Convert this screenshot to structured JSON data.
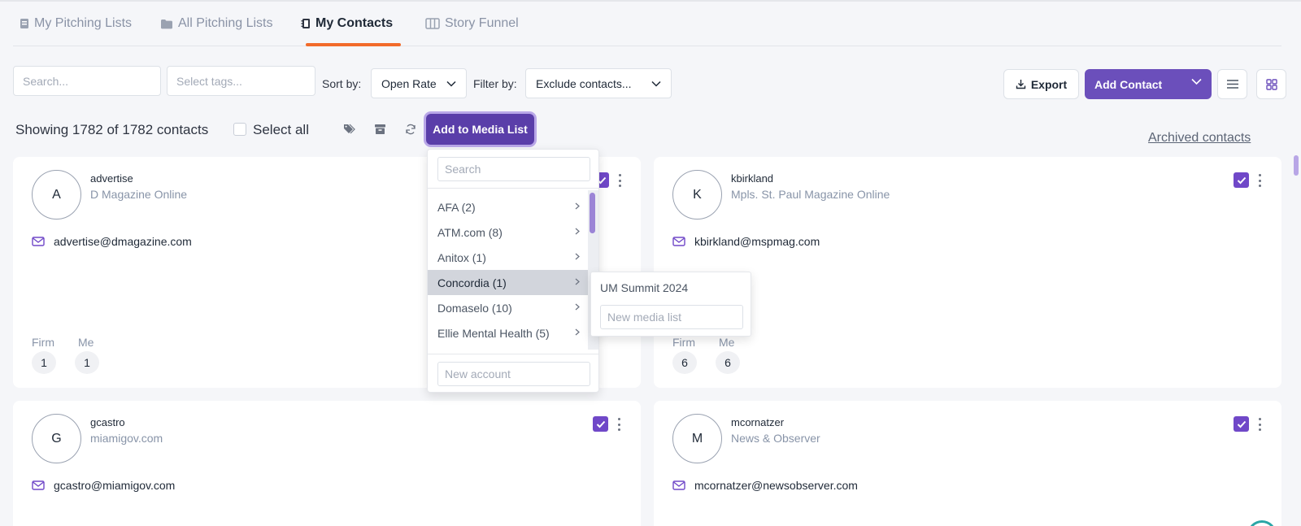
{
  "tabs": [
    {
      "label": "My Pitching Lists",
      "icon": "clipboard-icon"
    },
    {
      "label": "All Pitching Lists",
      "icon": "folder-icon"
    },
    {
      "label": "My Contacts",
      "icon": "contacts-book-icon",
      "active": true
    },
    {
      "label": "Story Funnel",
      "icon": "columns-icon"
    }
  ],
  "toolbar": {
    "search_placeholder": "Search...",
    "tags_placeholder": "Select tags...",
    "sort_label": "Sort by:",
    "sort_value": "Open Rate",
    "filter_label": "Filter by:",
    "filter_value": "Exclude contacts...",
    "export_label": "Export",
    "add_contact_label": "Add Contact"
  },
  "summary": {
    "showing_text": "Showing 1782 of 1782 contacts",
    "select_all_label": "Select all",
    "add_to_media_list_label": "Add to Media List",
    "archived_link": "Archived contacts"
  },
  "media_dropdown": {
    "search_placeholder": "Search",
    "accounts": [
      {
        "label": "AFA (2)"
      },
      {
        "label": "ATM.com (8)"
      },
      {
        "label": "Anitox (1)"
      },
      {
        "label": "Concordia (1)",
        "highlighted": true
      },
      {
        "label": "Domaselo (10)"
      },
      {
        "label": "Ellie Mental Health (5)"
      }
    ],
    "new_account_placeholder": "New account",
    "submenu": {
      "lists": [
        "UM Summit 2024"
      ],
      "new_list_placeholder": "New media list"
    }
  },
  "contacts": [
    {
      "initial": "A",
      "name": "advertise",
      "outlet": "D Magazine Online",
      "email": "advertise@dmagazine.com",
      "firm_label": "Firm",
      "firm_count": "1",
      "me_label": "Me",
      "me_count": "1",
      "selected": true
    },
    {
      "initial": "K",
      "name": "kbirkland",
      "outlet": "Mpls. St. Paul Magazine Online",
      "email": "kbirkland@mspmag.com",
      "firm_label": "Firm",
      "firm_count": "6",
      "me_label": "Me",
      "me_count": "6",
      "selected": true
    },
    {
      "initial": "G",
      "name": "gcastro",
      "outlet": "miamigov.com",
      "email": "gcastro@miamigov.com",
      "selected": true
    },
    {
      "initial": "M",
      "name": "mcornatzer",
      "outlet": "News & Observer",
      "email": "mcornatzer@newsobserver.com",
      "selected": true
    }
  ],
  "colors": {
    "accent": "#6b4fbb",
    "tab_underline": "#f26b2a",
    "checkbox": "#7048c8"
  }
}
